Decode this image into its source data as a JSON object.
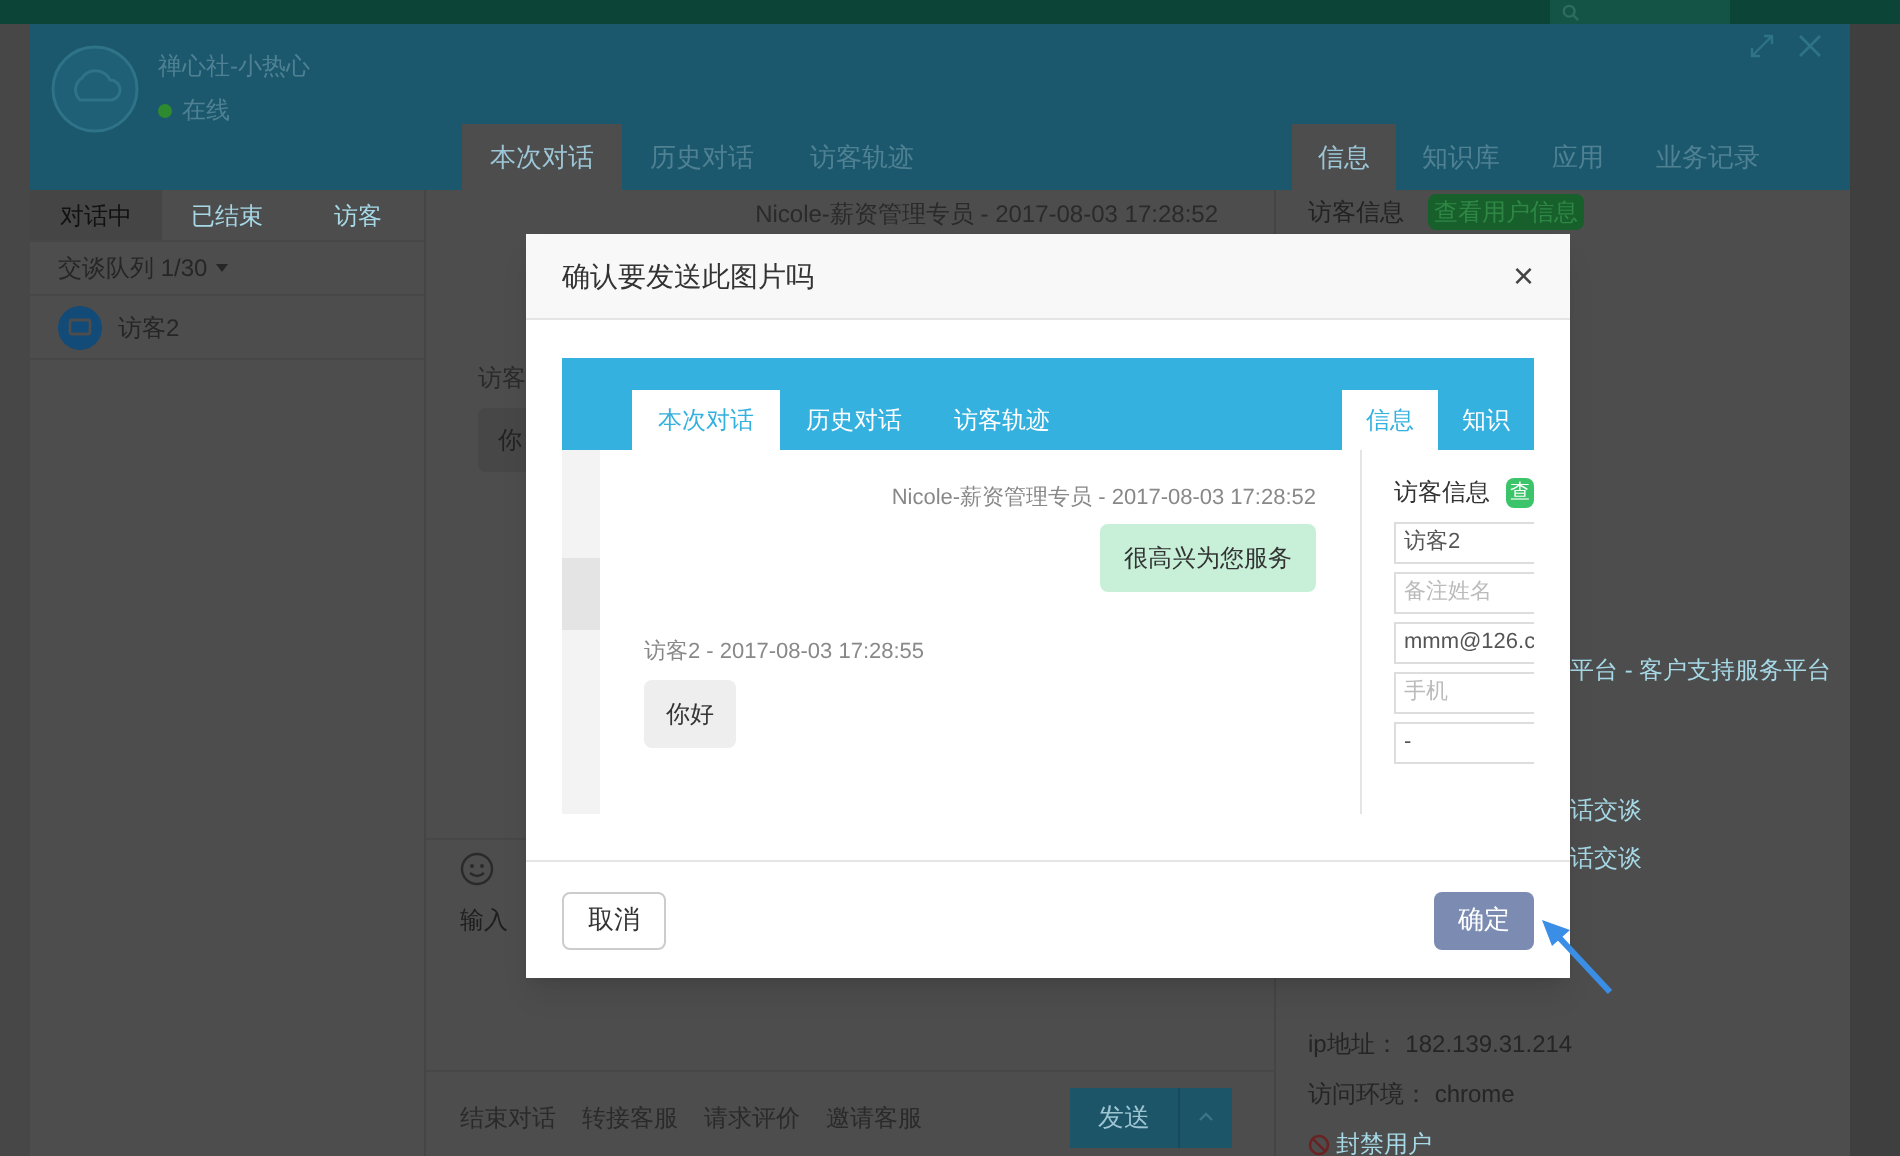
{
  "agent": {
    "name": "禅心社-小热心",
    "status": "在线",
    "online": true
  },
  "chat_tabs": [
    {
      "label": "本次对话",
      "selected": true
    },
    {
      "label": "历史对话",
      "selected": false
    },
    {
      "label": "访客轨迹",
      "selected": false
    }
  ],
  "info_tabs": [
    {
      "label": "信息",
      "selected": true
    },
    {
      "label": "知识库",
      "selected": false
    },
    {
      "label": "应用",
      "selected": false
    },
    {
      "label": "业务记录",
      "selected": false
    }
  ],
  "list_tabs": [
    {
      "label": "对话中",
      "selected": true
    },
    {
      "label": "已结束",
      "selected": false
    },
    {
      "label": "访客",
      "selected": false
    }
  ],
  "queue": "交谈队列 1/30",
  "visitors": [
    {
      "name": "访客2"
    }
  ],
  "chat": {
    "agent_line": "Nicole-薪资管理专员 - 2017-08-03 17:28:52",
    "visitor_line": "访客",
    "visitor_message": "你"
  },
  "composer": {
    "placeholder": "输入",
    "actions": [
      "结束对话",
      "转接客服",
      "请求评价",
      "邀请客服"
    ],
    "send": "发送"
  },
  "info_panel": {
    "heading": "访客信息",
    "badge": "查看用户信息",
    "lines": [
      "平台 - 客户支持服务平台",
      "话交谈",
      "话交谈"
    ],
    "ip": "ip地址： 182.139.31.214",
    "env": "访问环境： chrome",
    "ban": "封禁用户"
  },
  "dialog": {
    "title": "确认要发送此图片吗",
    "close": "×",
    "preview": {
      "chat_tabs": [
        {
          "label": "本次对话",
          "selected": true
        },
        {
          "label": "历史对话",
          "selected": false
        },
        {
          "label": "访客轨迹",
          "selected": false
        }
      ],
      "info_tabs": [
        {
          "label": "信息",
          "selected": true
        },
        {
          "label": "知识",
          "selected": false
        }
      ],
      "messages": [
        {
          "kind": "agent",
          "meta": "Nicole-薪资管理专员 - 2017-08-03 17:28:52",
          "text": "很高兴为您服务"
        },
        {
          "kind": "visitor",
          "meta": "访客2 - 2017-08-03 17:28:55",
          "text": "你好"
        }
      ],
      "info_heading": "访客信息",
      "info_badge": "查",
      "fields": [
        {
          "value": "访客2"
        },
        {
          "placeholder": "备注姓名"
        },
        {
          "value": "mmm@126.c"
        },
        {
          "placeholder": "手机"
        },
        {
          "value": "-"
        }
      ]
    },
    "buttons": [
      {
        "label": "取消",
        "kind": "default"
      },
      {
        "label": "确定",
        "kind": "primary"
      }
    ]
  }
}
